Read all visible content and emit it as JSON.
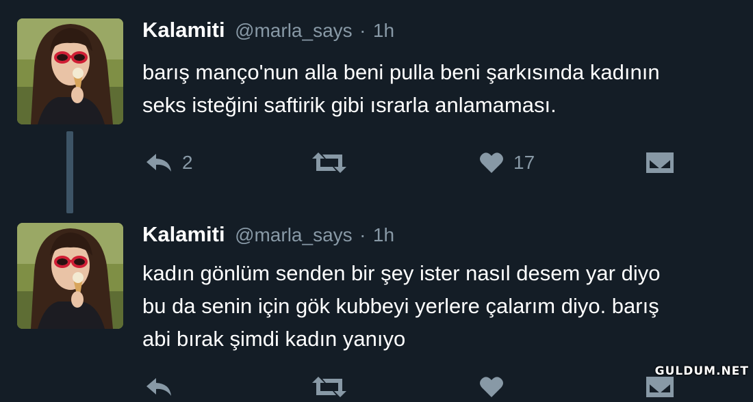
{
  "tweets": [
    {
      "author": "Kalamiti",
      "handle": "@marla_says",
      "separator": "·",
      "time": "1h",
      "text": "barış manço'nun alla beni pulla beni şarkısında kadının\nseks isteğini saftirik gibi ısrarla anlamaması.",
      "actions": {
        "reply_icon": "reply-icon",
        "reply_count": "2",
        "retweet_icon": "retweet-icon",
        "like_icon": "heart-icon",
        "like_count": "17",
        "dm_icon": "envelope-icon"
      }
    },
    {
      "author": "Kalamiti",
      "handle": "@marla_says",
      "separator": "·",
      "time": "1h",
      "text": "kadın gönlüm senden bir şey ister nasıl desem yar diyo\nbu da senin için gök kubbeyi yerlere çalarım diyo. barış\nabi bırak şimdi kadın yanıyo",
      "actions": {
        "reply_icon": "reply-icon",
        "retweet_icon": "retweet-icon",
        "like_icon": "heart-icon",
        "dm_icon": "envelope-icon"
      }
    }
  ],
  "colors": {
    "background": "#141d26",
    "text": "#ffffff",
    "muted": "#8899a6",
    "thread_line": "#3d5466"
  },
  "watermark": "GULDUM.NET"
}
